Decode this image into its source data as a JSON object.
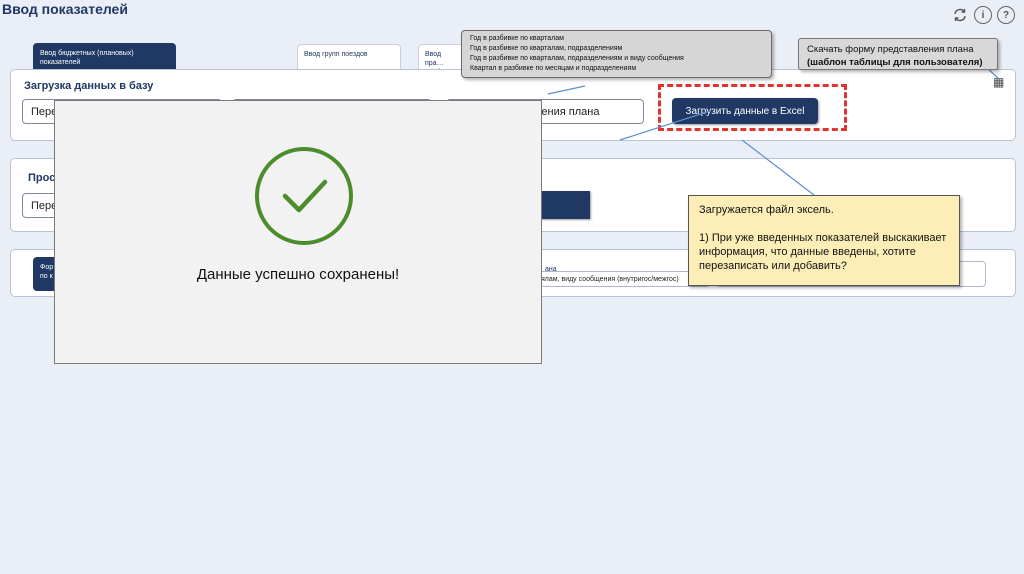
{
  "header": {
    "title": "Ввод показателей",
    "refresh_icon": "refresh-icon",
    "info_label": "i",
    "help_label": "?"
  },
  "tabs": [
    {
      "label": "Ввод бюджетных (плановых) показателей",
      "active": true
    },
    {
      "label": "Ввод групп поездов",
      "active": false
    },
    {
      "label": "Ввод пра… дней в ка…",
      "active": false
    }
  ],
  "callouts": {
    "period_options": [
      "Год в разбивке по кварталам",
      "Год в разбивке по кварталам, подразделениям",
      "Год в разбивке по кварталам, подразделениям и виду сообщения",
      "Квартал в разбивке по месяцам и подразделениям"
    ],
    "template_line1": "Скачать форму представления плана",
    "template_line2": "(шаблон таблицы для пользователя)",
    "excel_loading_title": "Загружается файл эксель.",
    "excel_loading_body": "1) При уже введенных показателей выскакивает информация, что данные введены, хотите перезаписать или добавить?"
  },
  "upload_panel": {
    "title": "Загрузка данных в базу",
    "field1": "Пере",
    "field3": "ления плана",
    "upload_button": "Загрузить данные в Excel"
  },
  "view_panel": {
    "title": "Прос",
    "field1": "Пере"
  },
  "bottom_panel": {
    "tab_label": "Фор по к",
    "text1": "ана",
    "text2": "ялам, виду сообщения (внутригос/межгос)"
  },
  "modal": {
    "message": "Данные успешно сохранены!"
  },
  "colors": {
    "primary": "#1f3864",
    "success": "#4c8c2b",
    "dashed": "#e2332b",
    "note": "#fdeeb8"
  }
}
